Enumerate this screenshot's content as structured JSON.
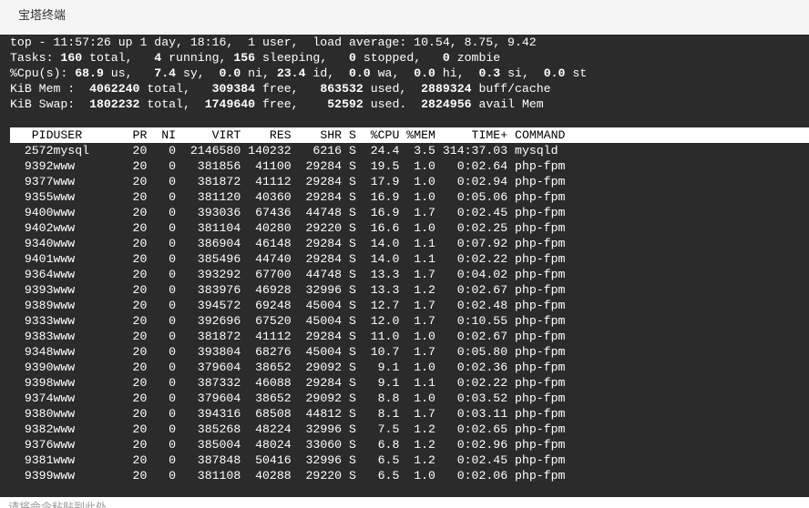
{
  "window": {
    "title": "宝塔终端"
  },
  "summary": {
    "line1": "top - 11:57:26 up 1 day, 18:16,  1 user,  load average: 10.54, 8.75, 9.42",
    "tasks": {
      "prefix": "Tasks: ",
      "total": "160",
      "total_label": " total,   ",
      "running": "4",
      "running_label": " running, ",
      "sleeping": "156",
      "sleeping_label": " sleeping,   ",
      "stopped": "0",
      "stopped_label": " stopped,   ",
      "zombie": "0",
      "zombie_label": " zombie"
    },
    "cpu": {
      "prefix": "%Cpu(s): ",
      "us": "68.9",
      "us_label": " us,  ",
      "sy": " 7.4",
      "sy_label": " sy,  ",
      "ni": "0.0",
      "ni_label": " ni, ",
      "id": "23.4",
      "id_label": " id,  ",
      "wa": "0.0",
      "wa_label": " wa,  ",
      "hi": "0.0",
      "hi_label": " hi,  ",
      "si": "0.3",
      "si_label": " si,  ",
      "st": "0.0",
      "st_label": " st"
    },
    "mem": {
      "prefix": "KiB Mem :  ",
      "total": "4062240",
      "total_label": " total,   ",
      "free": "309384",
      "free_label": " free,   ",
      "used": "863532",
      "used_label": " used,  ",
      "cache": "2889324",
      "cache_label": " buff/cache"
    },
    "swap": {
      "prefix": "KiB Swap:  ",
      "total": "1802232",
      "total_label": " total,  ",
      "free": "1749640",
      "free_label": " free,    ",
      "used": "52592",
      "used_label": " used.  ",
      "avail": "2824956",
      "avail_label": " avail Mem"
    }
  },
  "columns": [
    "PID",
    "USER",
    "PR",
    "NI",
    "VIRT",
    "RES",
    "SHR",
    "S",
    "%CPU",
    "%MEM",
    "TIME+",
    "COMMAND"
  ],
  "processes": [
    {
      "pid": "2572",
      "user": "mysql",
      "pr": "20",
      "ni": "0",
      "virt": "2146580",
      "res": "140232",
      "shr": "6216",
      "s": "S",
      "cpu": "24.4",
      "mem": "3.5",
      "time": "314:37.03",
      "command": "mysqld"
    },
    {
      "pid": "9392",
      "user": "www",
      "pr": "20",
      "ni": "0",
      "virt": "381856",
      "res": "41100",
      "shr": "29284",
      "s": "S",
      "cpu": "19.5",
      "mem": "1.0",
      "time": "0:02.64",
      "command": "php-fpm"
    },
    {
      "pid": "9377",
      "user": "www",
      "pr": "20",
      "ni": "0",
      "virt": "381872",
      "res": "41112",
      "shr": "29284",
      "s": "S",
      "cpu": "17.9",
      "mem": "1.0",
      "time": "0:02.94",
      "command": "php-fpm"
    },
    {
      "pid": "9355",
      "user": "www",
      "pr": "20",
      "ni": "0",
      "virt": "381120",
      "res": "40360",
      "shr": "29284",
      "s": "S",
      "cpu": "16.9",
      "mem": "1.0",
      "time": "0:05.06",
      "command": "php-fpm"
    },
    {
      "pid": "9400",
      "user": "www",
      "pr": "20",
      "ni": "0",
      "virt": "393036",
      "res": "67436",
      "shr": "44748",
      "s": "S",
      "cpu": "16.9",
      "mem": "1.7",
      "time": "0:02.45",
      "command": "php-fpm"
    },
    {
      "pid": "9402",
      "user": "www",
      "pr": "20",
      "ni": "0",
      "virt": "381104",
      "res": "40280",
      "shr": "29220",
      "s": "S",
      "cpu": "16.6",
      "mem": "1.0",
      "time": "0:02.25",
      "command": "php-fpm"
    },
    {
      "pid": "9340",
      "user": "www",
      "pr": "20",
      "ni": "0",
      "virt": "386904",
      "res": "46148",
      "shr": "29284",
      "s": "S",
      "cpu": "14.0",
      "mem": "1.1",
      "time": "0:07.92",
      "command": "php-fpm"
    },
    {
      "pid": "9401",
      "user": "www",
      "pr": "20",
      "ni": "0",
      "virt": "385496",
      "res": "44740",
      "shr": "29284",
      "s": "S",
      "cpu": "14.0",
      "mem": "1.1",
      "time": "0:02.22",
      "command": "php-fpm"
    },
    {
      "pid": "9364",
      "user": "www",
      "pr": "20",
      "ni": "0",
      "virt": "393292",
      "res": "67700",
      "shr": "44748",
      "s": "S",
      "cpu": "13.3",
      "mem": "1.7",
      "time": "0:04.02",
      "command": "php-fpm"
    },
    {
      "pid": "9393",
      "user": "www",
      "pr": "20",
      "ni": "0",
      "virt": "383976",
      "res": "46928",
      "shr": "32996",
      "s": "S",
      "cpu": "13.3",
      "mem": "1.2",
      "time": "0:02.67",
      "command": "php-fpm"
    },
    {
      "pid": "9389",
      "user": "www",
      "pr": "20",
      "ni": "0",
      "virt": "394572",
      "res": "69248",
      "shr": "45004",
      "s": "S",
      "cpu": "12.7",
      "mem": "1.7",
      "time": "0:02.48",
      "command": "php-fpm"
    },
    {
      "pid": "9333",
      "user": "www",
      "pr": "20",
      "ni": "0",
      "virt": "392696",
      "res": "67520",
      "shr": "45004",
      "s": "S",
      "cpu": "12.0",
      "mem": "1.7",
      "time": "0:10.55",
      "command": "php-fpm"
    },
    {
      "pid": "9383",
      "user": "www",
      "pr": "20",
      "ni": "0",
      "virt": "381872",
      "res": "41112",
      "shr": "29284",
      "s": "S",
      "cpu": "11.0",
      "mem": "1.0",
      "time": "0:02.67",
      "command": "php-fpm"
    },
    {
      "pid": "9348",
      "user": "www",
      "pr": "20",
      "ni": "0",
      "virt": "393804",
      "res": "68276",
      "shr": "45004",
      "s": "S",
      "cpu": "10.7",
      "mem": "1.7",
      "time": "0:05.80",
      "command": "php-fpm"
    },
    {
      "pid": "9390",
      "user": "www",
      "pr": "20",
      "ni": "0",
      "virt": "379604",
      "res": "38652",
      "shr": "29092",
      "s": "S",
      "cpu": "9.1",
      "mem": "1.0",
      "time": "0:02.36",
      "command": "php-fpm"
    },
    {
      "pid": "9398",
      "user": "www",
      "pr": "20",
      "ni": "0",
      "virt": "387332",
      "res": "46088",
      "shr": "29284",
      "s": "S",
      "cpu": "9.1",
      "mem": "1.1",
      "time": "0:02.22",
      "command": "php-fpm"
    },
    {
      "pid": "9374",
      "user": "www",
      "pr": "20",
      "ni": "0",
      "virt": "379604",
      "res": "38652",
      "shr": "29092",
      "s": "S",
      "cpu": "8.8",
      "mem": "1.0",
      "time": "0:03.52",
      "command": "php-fpm"
    },
    {
      "pid": "9380",
      "user": "www",
      "pr": "20",
      "ni": "0",
      "virt": "394316",
      "res": "68508",
      "shr": "44812",
      "s": "S",
      "cpu": "8.1",
      "mem": "1.7",
      "time": "0:03.11",
      "command": "php-fpm"
    },
    {
      "pid": "9382",
      "user": "www",
      "pr": "20",
      "ni": "0",
      "virt": "385268",
      "res": "48224",
      "shr": "32996",
      "s": "S",
      "cpu": "7.5",
      "mem": "1.2",
      "time": "0:02.65",
      "command": "php-fpm"
    },
    {
      "pid": "9376",
      "user": "www",
      "pr": "20",
      "ni": "0",
      "virt": "385004",
      "res": "48024",
      "shr": "33060",
      "s": "S",
      "cpu": "6.8",
      "mem": "1.2",
      "time": "0:02.96",
      "command": "php-fpm"
    },
    {
      "pid": "9381",
      "user": "www",
      "pr": "20",
      "ni": "0",
      "virt": "387848",
      "res": "50416",
      "shr": "32996",
      "s": "S",
      "cpu": "6.5",
      "mem": "1.2",
      "time": "0:02.45",
      "command": "php-fpm"
    },
    {
      "pid": "9399",
      "user": "www",
      "pr": "20",
      "ni": "0",
      "virt": "381108",
      "res": "40288",
      "shr": "29220",
      "s": "S",
      "cpu": "6.5",
      "mem": "1.0",
      "time": "0:02.06",
      "command": "php-fpm"
    }
  ],
  "command_bar": {
    "hint": "请将命令粘贴到此处"
  },
  "colors": {
    "terminal_bg": "#2b2b2b",
    "terminal_fg": "#ffffff",
    "header_bg": "#ffffff",
    "header_fg": "#000000",
    "titlebar_bg": "#f5f5f5"
  }
}
